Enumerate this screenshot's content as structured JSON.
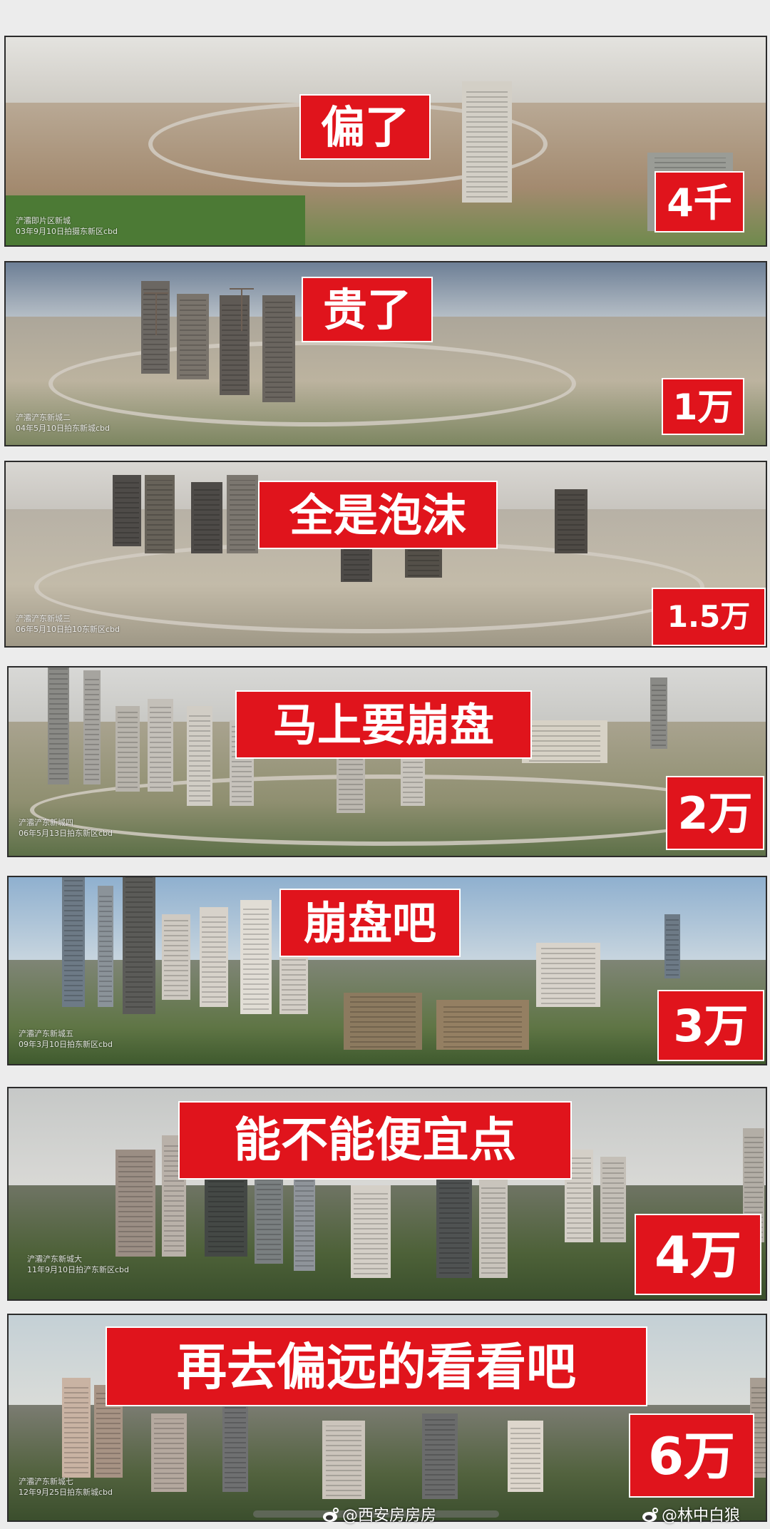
{
  "panels": [
    {
      "caption": "偏了",
      "price": "4千",
      "stamp_lines": [
        "浐灞即片区新城",
        "03年9月10日拍摄东新区cbd"
      ]
    },
    {
      "caption": "贵了",
      "price": "1万",
      "stamp_lines": [
        "浐灞浐东新城二",
        "04年5月10日拍东新城cbd"
      ]
    },
    {
      "caption": "全是泡沫",
      "price": "1.5万",
      "stamp_lines": [
        "浐灞浐东新城三",
        "06年5月10日拍10东新区cbd"
      ]
    },
    {
      "caption": "马上要崩盘",
      "price": "2万",
      "stamp_lines": [
        "浐灞浐东新城四",
        "06年5月13日拍东新区cbd"
      ]
    },
    {
      "caption": "崩盘吧",
      "price": "3万",
      "stamp_lines": [
        "浐灞浐东新城五",
        "09年3月10日拍东新区cbd"
      ]
    },
    {
      "caption": "能不能便宜点",
      "price": "4万",
      "stamp_lines": [
        "浐灞浐东新城大",
        "11年9月10日拍浐东新区cbd"
      ]
    },
    {
      "caption": "再去偏远的看看吧",
      "price": "6万",
      "stamp_lines": [
        "浐灞浐东新城七",
        "12年9月25日拍东新城cbd"
      ]
    }
  ],
  "watermarks": {
    "left": "@西安房房房",
    "right": "@林中白狼"
  },
  "colors": {
    "label_red": "#e0141c",
    "label_text": "#ffffff",
    "background": "#ececec"
  },
  "icons": [
    "weibo-icon"
  ]
}
